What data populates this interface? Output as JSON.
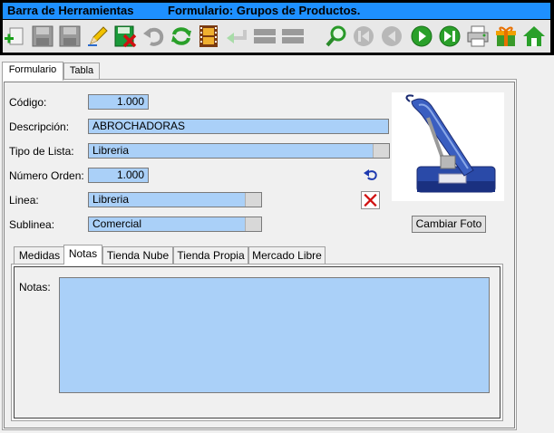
{
  "toolbar": {
    "title": "Barra de Herramientas",
    "form_title": "Formulario: Grupos de Productos.",
    "icons": [
      "add-icon",
      "save-icon",
      "save-as-icon",
      "edit-icon",
      "delete-save-icon",
      "undo-icon",
      "refresh-icon",
      "film-icon",
      "back-arrow-icon",
      "list-icon",
      "list2-icon",
      "search-icon",
      "first-icon",
      "prev-icon",
      "next-icon",
      "last-icon",
      "printer-icon",
      "gift-icon",
      "home-icon"
    ]
  },
  "tabs": {
    "form": "Formulario",
    "table": "Tabla"
  },
  "form": {
    "codigo_label": "Código:",
    "codigo_value": "1.000",
    "descripcion_label": "Descripción:",
    "descripcion_value": "ABROCHADORAS",
    "tipo_label": "Tipo de Lista:",
    "tipo_value": "Libreria",
    "orden_label": "Número Orden:",
    "orden_value": "1.000",
    "linea_label": "Linea:",
    "linea_value": "Libreria",
    "sublinea_label": "Sublinea:",
    "sublinea_value": "Comercial",
    "change_photo": "Cambiar Foto"
  },
  "subtabs": [
    "Medidas",
    "Notas",
    "Tienda Nube",
    "Tienda Propia",
    "Mercado Libre"
  ],
  "notes": {
    "label": "Notas:",
    "value": ""
  },
  "colors": {
    "title_bar": "#1e90ff",
    "field_bg": "#aad0f8",
    "accent_green": "#2aa02a"
  }
}
